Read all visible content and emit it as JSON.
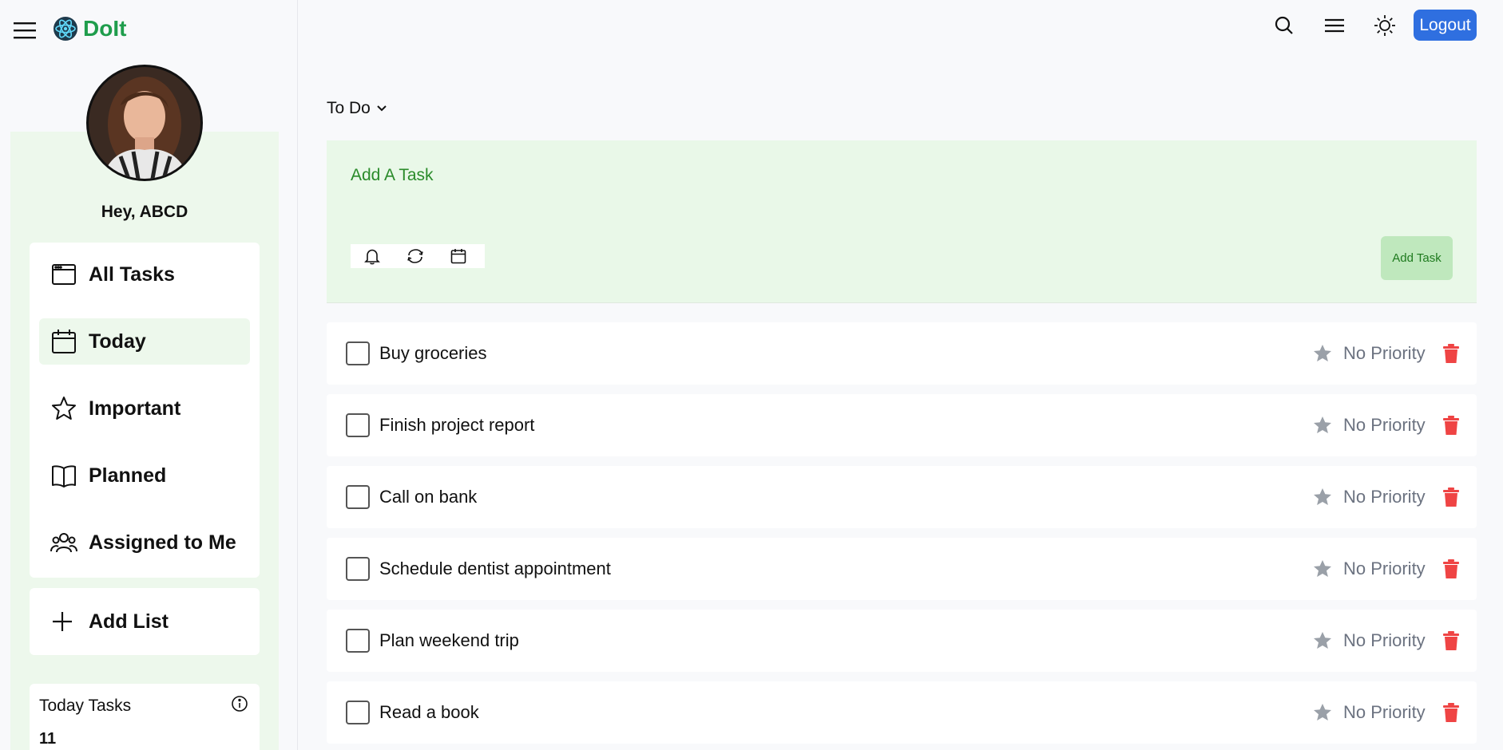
{
  "app": {
    "name": "DoIt",
    "greeting": "Hey, ABCD"
  },
  "colors": {
    "brand": "#1f9d4c",
    "sidebar_panel": "#edf8ec",
    "add_panel": "#e9f8e8",
    "logout_bg": "#2f6fe0",
    "delete": "#ef4444",
    "priority_gray": "#6b7280"
  },
  "header": {
    "logout_label": "Logout",
    "icons": [
      "search-icon",
      "menu-icon",
      "sun-icon"
    ]
  },
  "sidebar": {
    "items": [
      {
        "label": "All Tasks",
        "icon": "browser-window-icon",
        "active": false
      },
      {
        "label": "Today",
        "icon": "calendar-icon",
        "active": true
      },
      {
        "label": "Important",
        "icon": "star-icon",
        "active": false
      },
      {
        "label": "Planned",
        "icon": "book-icon",
        "active": false
      },
      {
        "label": "Assigned to Me",
        "icon": "people-icon",
        "active": false
      }
    ],
    "add_list_label": "Add List",
    "today_tasks": {
      "title": "Today Tasks",
      "count": "11"
    }
  },
  "main": {
    "list_title": "To Do",
    "add_task": {
      "placeholder": "Add A Task",
      "button_label": "Add Task",
      "tools": [
        "bell-icon",
        "repeat-icon",
        "calendar-icon"
      ]
    },
    "tasks": [
      {
        "title": "Buy groceries",
        "priority": "No Priority"
      },
      {
        "title": "Finish project report",
        "priority": "No Priority"
      },
      {
        "title": "Call on bank",
        "priority": "No Priority"
      },
      {
        "title": "Schedule dentist appointment",
        "priority": "No Priority"
      },
      {
        "title": "Plan weekend trip",
        "priority": "No Priority"
      },
      {
        "title": "Read a book",
        "priority": "No Priority"
      }
    ]
  }
}
